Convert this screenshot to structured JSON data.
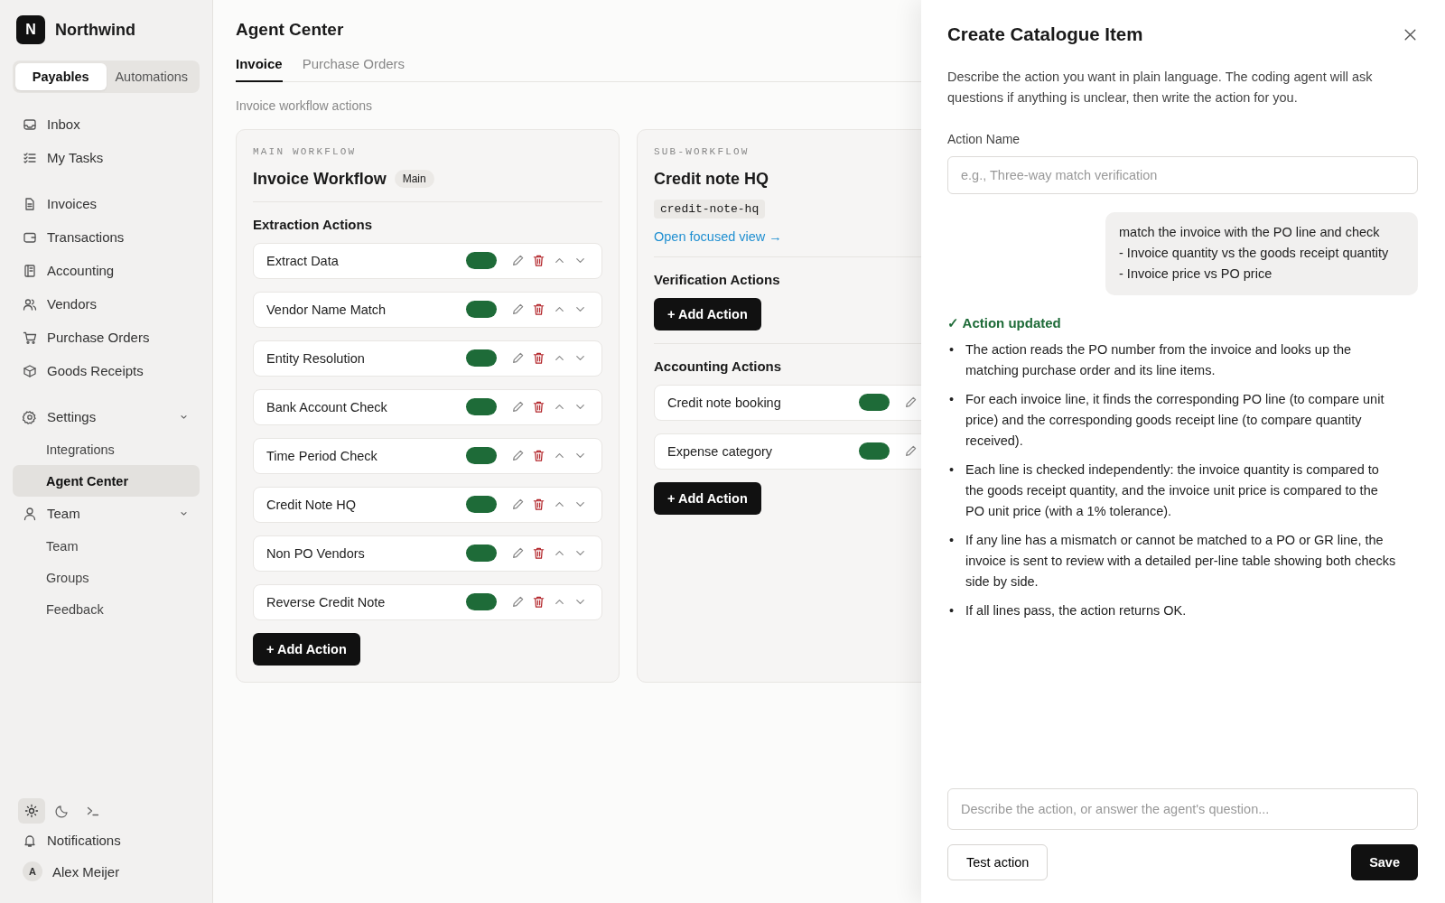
{
  "sidebar": {
    "brand": {
      "logo": "N",
      "name": "Northwind"
    },
    "switcher": [
      {
        "label": "Payables",
        "selected": true
      },
      {
        "label": "Automations",
        "selected": false
      }
    ],
    "nav_groups": [
      [
        {
          "label": "Inbox",
          "selected": false
        },
        {
          "label": "My Tasks",
          "selected": false
        }
      ],
      [
        {
          "label": "Invoices",
          "selected": false
        },
        {
          "label": "Transactions",
          "selected": false
        },
        {
          "label": "Accounting",
          "selected": false
        },
        {
          "label": "Vendors",
          "selected": false
        },
        {
          "label": "Purchase Orders",
          "selected": false
        },
        {
          "label": "Goods Receipts",
          "selected": false
        }
      ],
      [
        {
          "label": "Settings",
          "selected": false,
          "expanded": true,
          "children": [
            {
              "label": "Integrations",
              "selected": false
            },
            {
              "label": "Agent Center",
              "selected": true
            }
          ]
        },
        {
          "label": "Team",
          "selected": false,
          "expanded": true,
          "children": [
            {
              "label": "Team",
              "selected": false
            },
            {
              "label": "Groups",
              "selected": false
            },
            {
              "label": "Feedback",
              "selected": false
            }
          ]
        }
      ]
    ],
    "theme_options": [
      {
        "selected": true
      },
      {
        "selected": false
      },
      {
        "selected": false
      }
    ],
    "notifications": "Notifications",
    "user": {
      "initial": "A",
      "name": "Alex Meijer"
    }
  },
  "main": {
    "title": "Agent Center",
    "tabs": [
      {
        "label": "Invoice",
        "selected": true
      },
      {
        "label": "Purchase Orders",
        "selected": false
      }
    ],
    "subtitle": "Invoice workflow actions",
    "workflows": [
      {
        "kind": "main",
        "eyebrow": "MAIN WORKFLOW",
        "title": "Invoice Workflow",
        "badge": "Main",
        "sections": [
          {
            "title": "Extraction Actions",
            "actions": [
              {
                "name": "Extract Data",
                "enabled": true
              },
              {
                "name": "Vendor Name Match",
                "enabled": true
              },
              {
                "name": "Entity Resolution",
                "enabled": true
              },
              {
                "name": "Bank Account Check",
                "enabled": true
              },
              {
                "name": "Time Period Check",
                "enabled": true
              },
              {
                "name": "Credit Note HQ",
                "enabled": true
              },
              {
                "name": "Non PO Vendors",
                "enabled": true
              },
              {
                "name": "Reverse Credit Note",
                "enabled": true
              }
            ],
            "add_button": "+ Add Action"
          }
        ]
      },
      {
        "kind": "sub",
        "eyebrow": "SUB-WORKFLOW",
        "title": "Credit note HQ",
        "slug": "credit-note-hq",
        "link": "Open focused view →",
        "sections": [
          {
            "title": "Verification Actions",
            "add_button": "+ Add Action"
          },
          {
            "title": "Accounting Actions",
            "actions": [
              {
                "name": "Credit note booking",
                "enabled": true
              },
              {
                "name": "Expense category",
                "enabled": true
              }
            ],
            "add_button": "+ Add Action"
          }
        ]
      }
    ]
  },
  "drawer": {
    "title": "Create Catalogue Item",
    "description": "Describe the action you want in plain language. The coding agent will ask questions if anything is unclear, then write the action for you.",
    "name_label": "Action Name",
    "name_field": {
      "placeholder": "e.g., Three-way match verification"
    },
    "user_message": [
      "match the invoice with the PO line and check",
      "- Invoice quantity vs the goods receipt quantity",
      "- Invoice price vs PO price"
    ],
    "status": "✓ Action updated",
    "bullets": [
      {
        "marker": "•",
        "text": "The action reads the PO number from the invoice and looks up the matching purchase order and its line items."
      },
      {
        "marker": "•",
        "text": "For each invoice line, it finds the corresponding PO line (to compare unit price) and the corresponding goods receipt line (to compare quantity received)."
      },
      {
        "marker": "•",
        "text": "Each line is checked independently: the invoice quantity is compared to the goods receipt quantity, and the invoice unit price is compared to the PO unit price (with a 1% tolerance)."
      },
      {
        "marker": "•",
        "text": "If any line has a mismatch or cannot be matched to a PO or GR line, the invoice is sent to review with a detailed per-line table showing both checks side by side."
      },
      {
        "marker": "•",
        "text": "If all lines pass, the action returns OK."
      }
    ],
    "message_field": {
      "placeholder": "Describe the action, or answer the agent's question..."
    },
    "buttons": {
      "test": "Test action",
      "save": "Save"
    }
  }
}
